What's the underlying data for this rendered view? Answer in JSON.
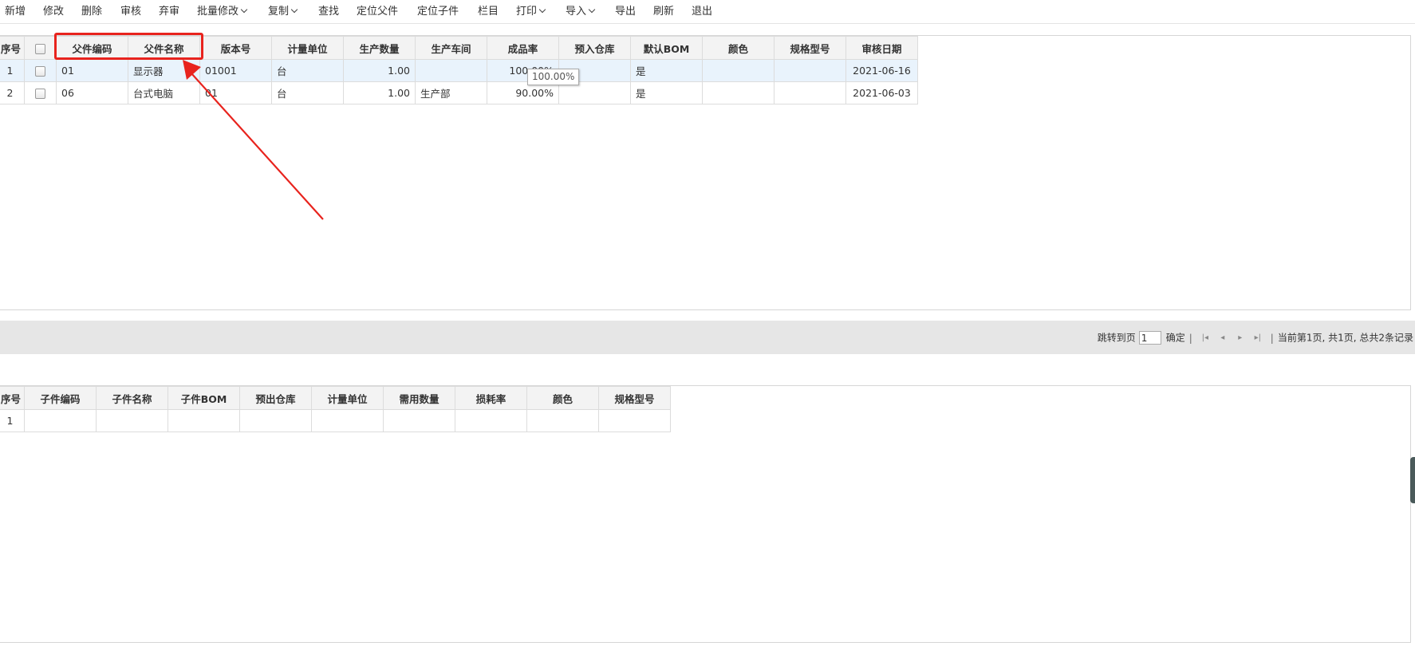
{
  "toolbar": {
    "items": [
      {
        "label": "新增",
        "dropdown": false
      },
      {
        "label": "修改",
        "dropdown": false
      },
      {
        "label": "删除",
        "dropdown": false
      },
      {
        "label": "审核",
        "dropdown": false
      },
      {
        "label": "弃审",
        "dropdown": false
      },
      {
        "label": "批量修改",
        "dropdown": true
      },
      {
        "label": "复制",
        "dropdown": true
      },
      {
        "label": "查找",
        "dropdown": false
      },
      {
        "label": "定位父件",
        "dropdown": false
      },
      {
        "label": "定位子件",
        "dropdown": false
      },
      {
        "label": "栏目",
        "dropdown": false
      },
      {
        "label": "打印",
        "dropdown": true
      },
      {
        "label": "导入",
        "dropdown": true
      },
      {
        "label": "导出",
        "dropdown": false
      },
      {
        "label": "刷新",
        "dropdown": false
      },
      {
        "label": "退出",
        "dropdown": false
      }
    ]
  },
  "parent_grid": {
    "headers": {
      "seq": "序号",
      "code": "父件编码",
      "name": "父件名称",
      "version": "版本号",
      "unit": "计量单位",
      "qty": "生产数量",
      "workshop": "生产车间",
      "yield": "成品率",
      "warehouse": "预入仓库",
      "default_bom": "默认BOM",
      "color": "颜色",
      "spec": "规格型号",
      "audit_date": "审核日期"
    },
    "rows": [
      {
        "seq": "1",
        "code": "01",
        "name": "显示器",
        "version": "01001",
        "unit": "台",
        "qty": "1.00",
        "workshop": "",
        "yield": "100.00%",
        "warehouse": "",
        "default_bom": "是",
        "color": "",
        "spec": "",
        "audit_date": "2021-06-16",
        "selected": true
      },
      {
        "seq": "2",
        "code": "06",
        "name": "台式电脑",
        "version": "01",
        "unit": "台",
        "qty": "1.00",
        "workshop": "生产部",
        "yield": "90.00%",
        "warehouse": "",
        "default_bom": "是",
        "color": "",
        "spec": "",
        "audit_date": "2021-06-03",
        "selected": false
      }
    ]
  },
  "tooltip": {
    "text": "100.00%"
  },
  "pager": {
    "jump_label": "跳转到页",
    "page_value": "1",
    "confirm_label": "确定",
    "sep": "|",
    "status": "当前第1页, 共1页, 总共2条记录"
  },
  "child_grid": {
    "headers": {
      "seq": "序号",
      "code": "子件编码",
      "name": "子件名称",
      "bom": "子件BOM",
      "warehouse": "预出仓库",
      "unit": "计量单位",
      "qty": "需用数量",
      "loss": "损耗率",
      "color": "颜色",
      "spec": "规格型号"
    },
    "rows": [
      {
        "seq": "1",
        "code": "",
        "name": "",
        "bom": "",
        "warehouse": "",
        "unit": "",
        "qty": "",
        "loss": "",
        "color": "",
        "spec": ""
      }
    ]
  },
  "colors": {
    "annotation": "#e8231d",
    "selected_row": "#e9f3fc",
    "pager_bg": "#e6e6e6",
    "header_bg": "#f3f3f3"
  }
}
